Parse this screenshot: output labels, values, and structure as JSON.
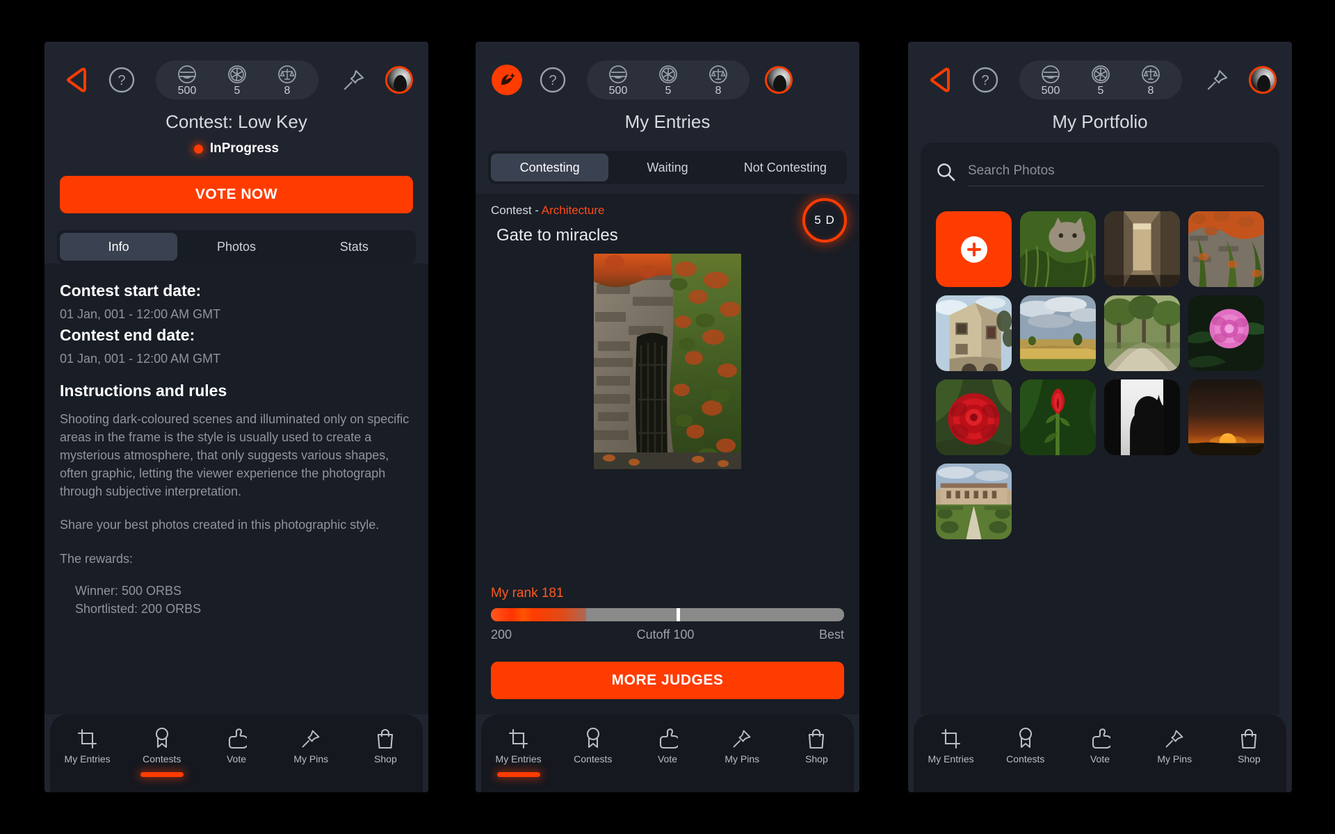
{
  "theme": {
    "accent": "#ff3c00",
    "bg": "#191d25",
    "panel": "#20242e",
    "muted": "#8f949d"
  },
  "topbar": {
    "orbs_value": "500",
    "shots_value": "5",
    "judge_value": "8",
    "icons": {
      "back": "back-arrow-icon",
      "logo": "app-logo-icon",
      "help": "help-icon",
      "orbs": "orb-icon",
      "shots": "aperture-icon",
      "judge": "scales-icon",
      "pin": "pushpin-icon",
      "avatar": "avatar"
    }
  },
  "panel1": {
    "title": "Contest: Low Key",
    "status": "InProgress",
    "cta_label": "VOTE NOW",
    "tabs": [
      {
        "label": "Info",
        "active": true
      },
      {
        "label": "Photos",
        "active": false
      },
      {
        "label": "Stats",
        "active": false
      }
    ],
    "start_label": "Contest start date:",
    "start_value": "01 Jan, 001 - 12:00 AM GMT",
    "end_label": "Contest end date:",
    "end_value": "01 Jan, 001 - 12:00 AM GMT",
    "rules_heading": "Instructions and rules",
    "rules_body": "Shooting dark-coloured scenes and illuminated only on specific areas in the frame is the style is usually used to create a mysterious atmosphere, that only suggests various shapes, often graphic, letting the viewer experience the photograph through subjective interpretation.",
    "share_body": "Share your best photos created in this photographic style.",
    "rewards_heading": "The rewards:",
    "reward_winner": "Winner: 500 ORBS",
    "reward_shortlisted": "Shortlisted: 200 ORBS"
  },
  "panel2": {
    "title": "My Entries",
    "tabs": [
      {
        "label": "Contesting",
        "active": true
      },
      {
        "label": "Waiting",
        "active": false
      },
      {
        "label": "Not Contesting",
        "active": false
      }
    ],
    "contest_prefix": "Contest - ",
    "contest_category": "Architecture",
    "entry_title": "Gate to miracles",
    "days_badge": "5 D",
    "rank_label": "My rank 181",
    "rank_scale_low": "200",
    "rank_scale_cutoff": "Cutoff 100",
    "rank_scale_best": "Best",
    "rank_fill_percent": 27,
    "rank_marker_percent": 52.5,
    "cta_label": "MORE JUDGES"
  },
  "panel3": {
    "title": "My Portfolio",
    "search_placeholder": "Search Photos",
    "search_value": "",
    "tiles": [
      {
        "name": "add-photo-button",
        "kind": "add"
      },
      {
        "name": "photo-cat-in-grass",
        "kind": "photo",
        "art": "cat"
      },
      {
        "name": "photo-corridor",
        "kind": "photo",
        "art": "corridor"
      },
      {
        "name": "photo-ivy-wall",
        "kind": "photo",
        "art": "ivy"
      },
      {
        "name": "photo-old-building",
        "kind": "photo",
        "art": "building"
      },
      {
        "name": "photo-field-clouds",
        "kind": "photo",
        "art": "field"
      },
      {
        "name": "photo-tree-path",
        "kind": "photo",
        "art": "path"
      },
      {
        "name": "photo-pink-peony",
        "kind": "photo",
        "art": "peony"
      },
      {
        "name": "photo-red-rose",
        "kind": "photo",
        "art": "rose"
      },
      {
        "name": "photo-rose-bud",
        "kind": "photo",
        "art": "bud"
      },
      {
        "name": "photo-silhouette",
        "kind": "photo",
        "art": "silhouette"
      },
      {
        "name": "photo-sunset",
        "kind": "photo",
        "art": "sunset"
      },
      {
        "name": "photo-manor-garden",
        "kind": "photo",
        "art": "manor"
      }
    ]
  },
  "bottomnav": {
    "items": [
      {
        "label": "My Entries",
        "icon": "crop-icon",
        "active": false
      },
      {
        "label": "Contests",
        "icon": "medal-icon",
        "active": false
      },
      {
        "label": "Vote",
        "icon": "thumbs-up-icon",
        "active": false
      },
      {
        "label": "My Pins",
        "icon": "pushpin-icon",
        "active": false
      },
      {
        "label": "Shop",
        "icon": "shopping-bag-icon",
        "active": false
      }
    ],
    "active_panel1": 1,
    "active_panel2": 0,
    "active_panel3": -1
  }
}
